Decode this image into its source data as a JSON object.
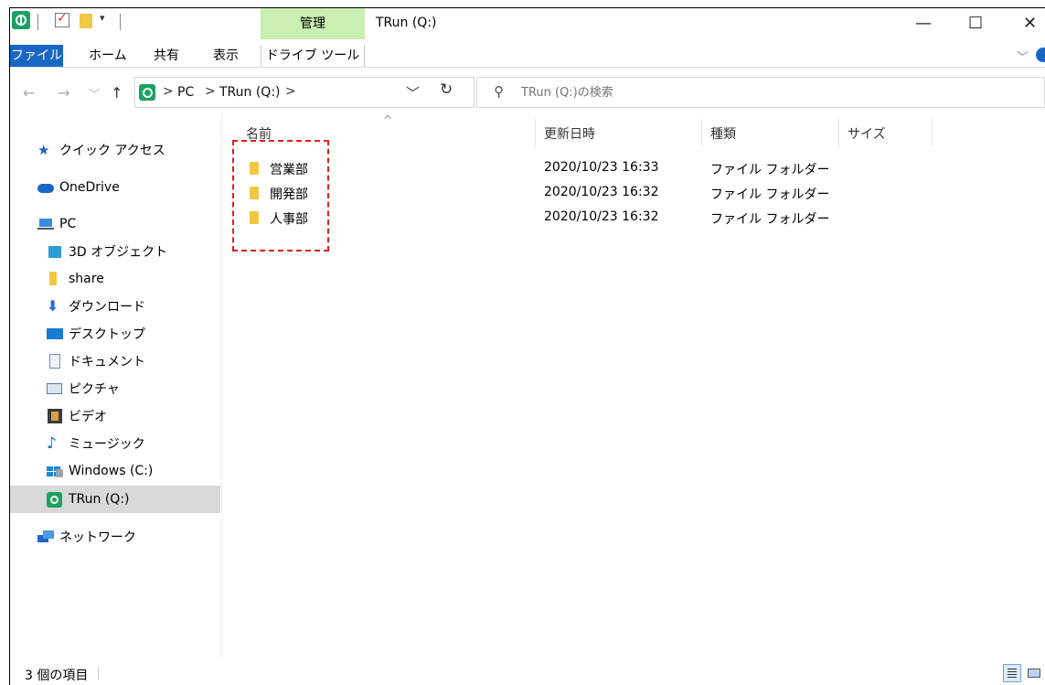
{
  "window": {
    "title": "TRun (Q:)",
    "context_tab": "管理",
    "controls": {
      "minimize": "—",
      "maximize": "☐",
      "close": "✕"
    }
  },
  "quick_access_toolbar": {
    "dropdown": "▾"
  },
  "ribbon": {
    "tabs": [
      {
        "label": "ファイル"
      },
      {
        "label": "ホーム"
      },
      {
        "label": "共有"
      },
      {
        "label": "表示"
      },
      {
        "label": "ドライブ ツール"
      }
    ],
    "collapse_chevron": "﹀"
  },
  "address_bar": {
    "back": "←",
    "forward": "→",
    "recent": "﹀",
    "up": "↑",
    "crumbs": [
      "PC",
      "TRun (Q:)"
    ],
    "crumb_arrow": ">",
    "dropdown": "﹀",
    "refresh": "↻"
  },
  "search": {
    "placeholder": "TRun (Q:)の検索",
    "icon": "⚲"
  },
  "sidebar": {
    "items": [
      {
        "label": "クイック アクセス",
        "icon": "star-icon",
        "color": "#1a66c4"
      },
      {
        "label": "OneDrive",
        "icon": "cloud-icon",
        "color": "#1a66c4"
      },
      {
        "label": "PC",
        "icon": "computer-icon",
        "color": "#3a8be0"
      },
      {
        "label": "3D オブジェクト",
        "icon": "cube-icon",
        "color": "#2e9bd6"
      },
      {
        "label": "share",
        "icon": "user-folder-icon",
        "color": "#f2c744"
      },
      {
        "label": "ダウンロード",
        "icon": "download-icon",
        "color": "#2a6fd1"
      },
      {
        "label": "デスクトップ",
        "icon": "desktop-icon",
        "color": "#1a7ad4"
      },
      {
        "label": "ドキュメント",
        "icon": "document-icon",
        "color": "#6d8fb3"
      },
      {
        "label": "ピクチャ",
        "icon": "picture-icon",
        "color": "#5b7fa6"
      },
      {
        "label": "ビデオ",
        "icon": "video-icon",
        "color": "#3b3b3b"
      },
      {
        "label": "ミュージック",
        "icon": "music-icon",
        "color": "#1a66c4"
      },
      {
        "label": "Windows (C:)",
        "icon": "windows-drive-icon",
        "color": "#1a88d6"
      },
      {
        "label": "TRun (Q:)",
        "icon": "trun-drive-icon",
        "color": "#1aa260"
      },
      {
        "label": "ネットワーク",
        "icon": "network-icon",
        "color": "#1a66c4"
      }
    ]
  },
  "columns": {
    "name": "名前",
    "modified": "更新日時",
    "type": "種類",
    "size": "サイズ",
    "sort_arrow": "^"
  },
  "files": [
    {
      "name": "営業部",
      "modified": "2020/10/23 16:33",
      "type": "ファイル フォルダー"
    },
    {
      "name": "開発部",
      "modified": "2020/10/23 16:32",
      "type": "ファイル フォルダー"
    },
    {
      "name": "人事部",
      "modified": "2020/10/23 16:32",
      "type": "ファイル フォルダー"
    }
  ],
  "status": {
    "item_count": "3 個の項目"
  },
  "colors": {
    "accent": "#1a66c4",
    "context_tab": "#c9efb2",
    "selection": "#d9d9d9",
    "highlight_box": "#e0201a",
    "folder": "#f2c744"
  }
}
